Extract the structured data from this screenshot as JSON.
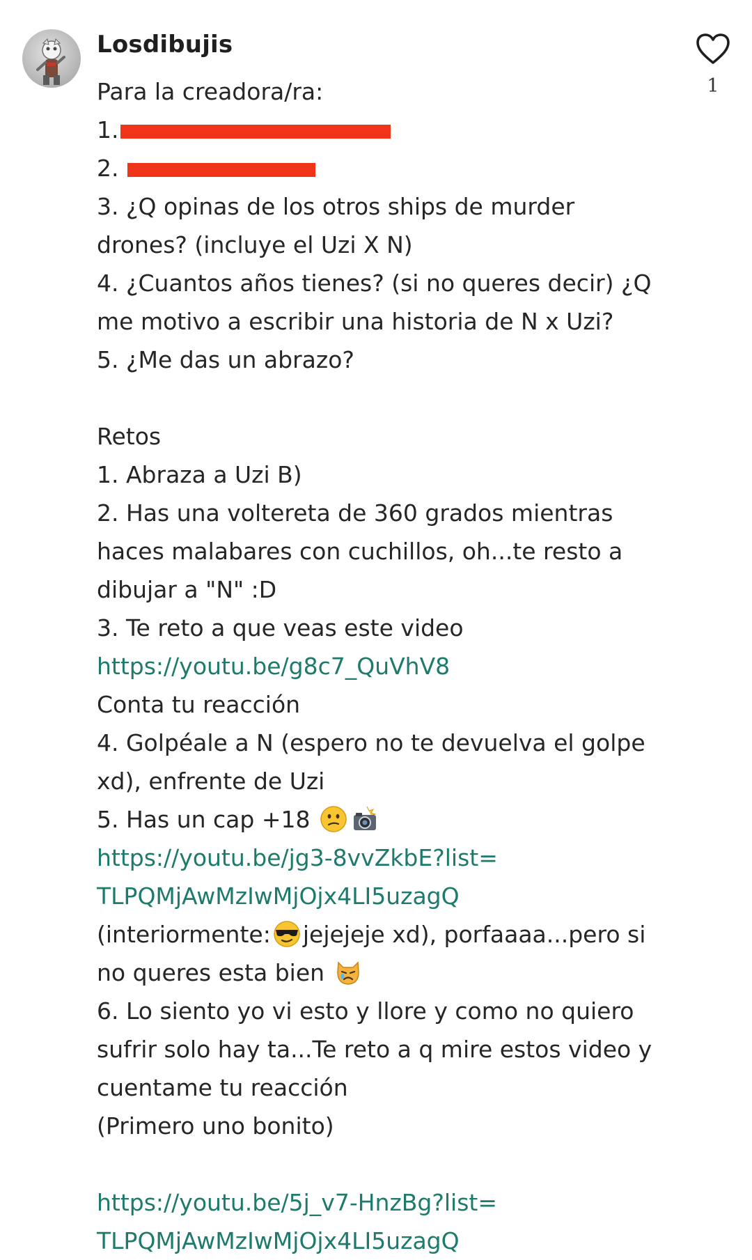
{
  "comment": {
    "username": "Losdibujis",
    "like_count": "1",
    "avatar_icon": "avatar-image",
    "like_icon": "heart-outline-icon",
    "link_color": "#1e7b6c",
    "redaction_color": "#f0341a",
    "lines": {
      "l1": "Para la creadora/ra:",
      "l2": "1.",
      "l3": "2.",
      "l4": "3. ¿Q opinas de los otros ships de murder",
      "l5": "drones? (incluye el Uzi X N)",
      "l6": "4. ¿Cuantos años tienes? (si no queres decir) ¿Q",
      "l7": "me motivo a escribir una historia de N x Uzi?",
      "l8": "5. ¿Me das un abrazo?",
      "l9": "Retos",
      "l10": "1. Abraza a Uzi B)",
      "l11": "2. Has una voltereta de 360 grados mientras",
      "l12": "haces malabares con cuchillos, oh...te resto a",
      "l13": "dibujar a \"N\" :D",
      "l14": "3. Te reto a que veas este video",
      "l15": "https://youtu.be/g8c7_QuVhV8",
      "l16": "Conta tu reacción",
      "l17": "4. Golpéale a N (espero no te devuelva el golpe",
      "l18": "xd), enfrente de Uzi",
      "l19": "5. Has un cap +18",
      "l20": "https://youtu.be/jg3-8vvZkbE?list=",
      "l21": "TLPQMjAwMzIwMjOjx4LI5uzagQ",
      "l22a": "(interiormente:",
      "l22b": "jejejeje xd), porfaaaa...pero si",
      "l23": "no queres esta bien",
      "l24": "6. Lo siento yo vi esto y llore y como no quiero",
      "l25": "sufrir solo hay ta...Te reto a q mire estos video y",
      "l26": "cuentame tu reacción",
      "l27": "(Primero uno bonito)",
      "l28": "https://youtu.be/5j_v7-HnzBg?list=",
      "l29": "TLPQMjAwMzIwMjOjx4LI5uzagQ"
    },
    "emojis": {
      "line19": [
        "confused-face-emoji",
        "camera-with-flash-emoji"
      ],
      "line22": "sunglasses-face-emoji",
      "line23": "crying-cat-emoji"
    }
  }
}
